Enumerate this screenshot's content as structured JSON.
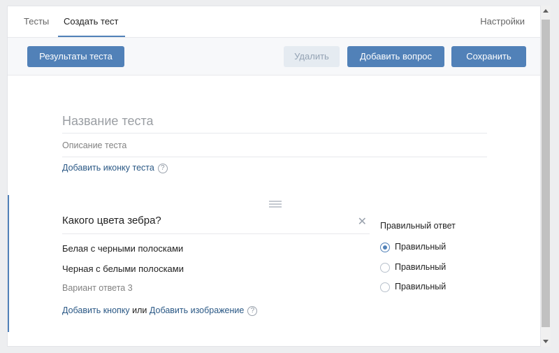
{
  "tabs": {
    "tests": "Тесты",
    "create": "Создать тест",
    "settings": "Настройки"
  },
  "toolbar": {
    "results": "Результаты теста",
    "delete": "Удалить",
    "add_question": "Добавить вопрос",
    "save": "Сохранить"
  },
  "test": {
    "title_placeholder": "Название теста",
    "description_placeholder": "Описание теста",
    "add_icon": "Добавить иконку теста",
    "help": "?"
  },
  "question": {
    "text": "Какого цвета зебра?",
    "clear": "✕",
    "answers": [
      "Белая с черными полосками",
      "Черная с белыми полосками",
      "Вариант ответа 3"
    ],
    "add_button": "Добавить кнопку",
    "or": " или ",
    "add_image": "Добавить изображение",
    "correct_header": "Правильный ответ",
    "correct_options": [
      "Правильный",
      "Правильный",
      "Правильный"
    ],
    "correct_selected_index": 0
  },
  "colors": {
    "accent": "#5181b8",
    "link": "#2a5885"
  },
  "icons": {
    "help": "question-circle-icon",
    "clear": "close-icon",
    "drag": "drag-handle-icon"
  }
}
